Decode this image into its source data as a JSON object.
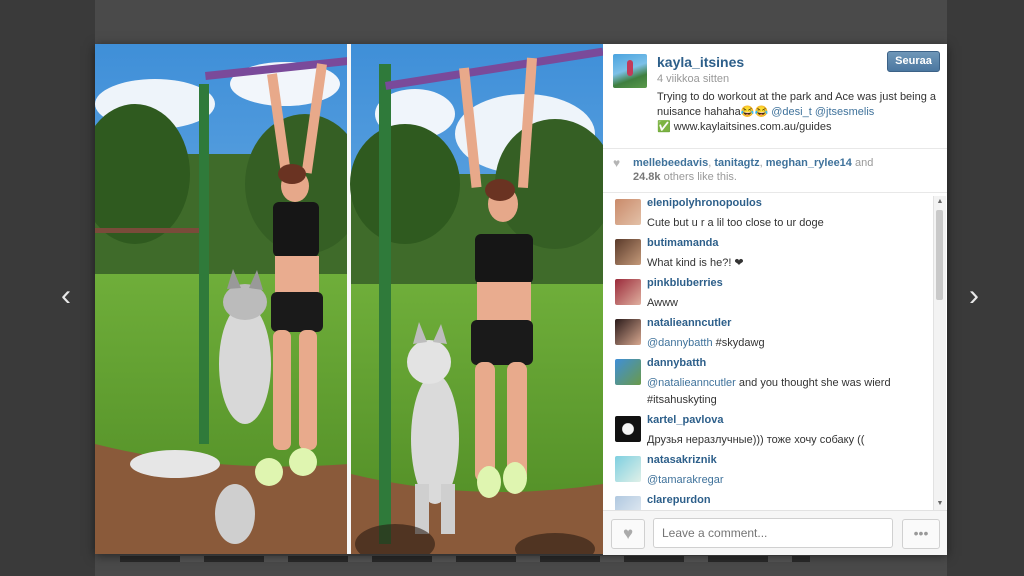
{
  "post": {
    "username": "kayla_itsines",
    "time_ago": "4 viikkoa sitten",
    "follow_label": "Seuraa",
    "caption_text": "Trying to do workout at the park and Ace was just being a nuisance hahaha😂😂",
    "caption_mentions": [
      "@desi_t",
      "@jtsesmelis"
    ],
    "caption_link": "✅ www.kaylaitsines.com.au/guides"
  },
  "likes": {
    "likers": [
      "mellebeedavis",
      "tanitagtz",
      "meghan_rylee14"
    ],
    "sep": ",",
    "and": "and",
    "others_count": "24.8k",
    "others_suffix": "others like this."
  },
  "comments": [
    {
      "user": "elenipolyhronopoulos",
      "text": "Cute but u r a lil too close to ur doge"
    },
    {
      "user": "butimamanda",
      "text": "What kind is he?! ❤"
    },
    {
      "user": "pinkbluberries",
      "text": "Awww"
    },
    {
      "user": "natalieanncutler",
      "mention": "@dannybatth",
      "text": "#skydawg"
    },
    {
      "user": "dannybatth",
      "mention": "@natalieanncutler",
      "text": "and you thought she was wierd #itsahuskyting"
    },
    {
      "user": "kartel_pavlova",
      "text": "Друзья неразлучные))) тоже хочу собаку (("
    },
    {
      "user": "natasakriznik",
      "mention": "@tamarakregar",
      "text": ""
    },
    {
      "user": "clarepurdon",
      "text": ""
    }
  ],
  "footer": {
    "comment_placeholder": "Leave a comment...",
    "more_label": "•••"
  },
  "icons": {
    "prev": "chevron-left-icon",
    "next": "chevron-right-icon",
    "heart": "heart-icon"
  }
}
